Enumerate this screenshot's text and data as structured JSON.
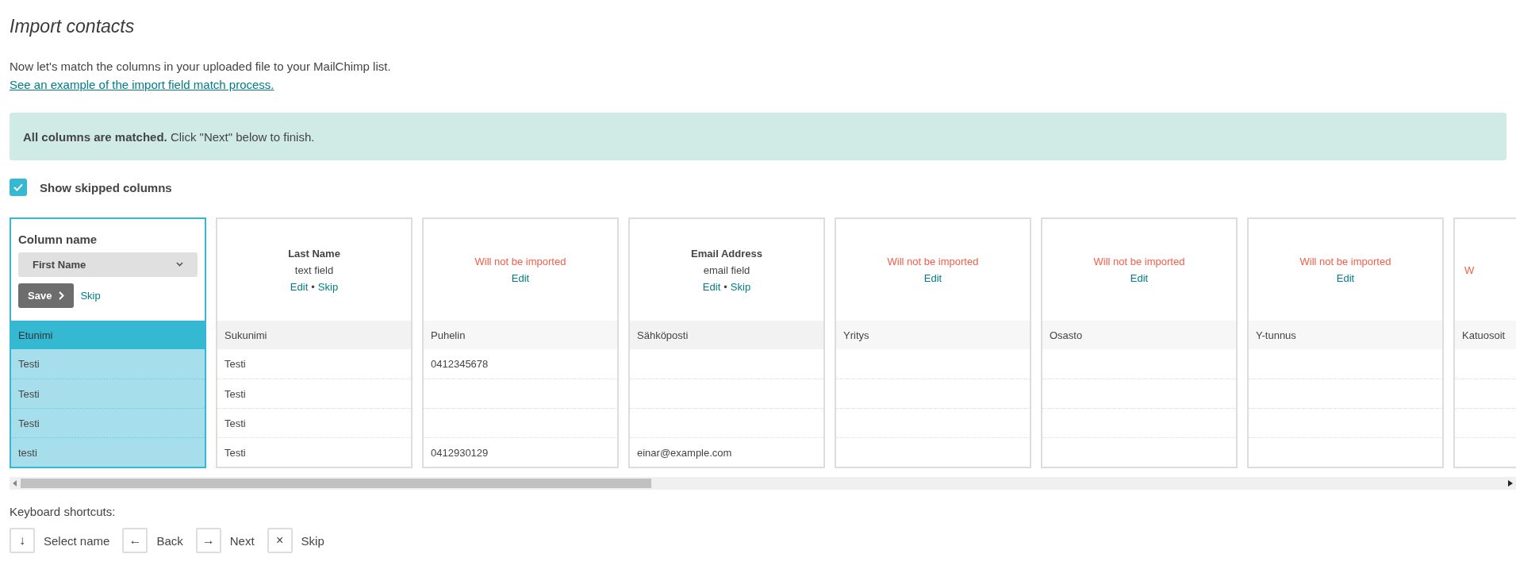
{
  "title": "Import contacts",
  "intro": "Now let's match the columns in your uploaded file to your MailChimp list.",
  "example_link": "See an example of the import field match process.",
  "notice": "**All columns are matched.** Click \"Next\" below to finish.",
  "show_skipped": {
    "label": "Show skipped columns",
    "checked": true
  },
  "columns": [
    {
      "kind": "editing",
      "selected": true,
      "label": "Column name",
      "select_value": "First Name",
      "save_button": "Save",
      "skip_link": "Skip",
      "header": "Etunimi",
      "cells": [
        {
          "text": "Testi"
        },
        {
          "text": "Testi"
        },
        {
          "text": "Testi"
        },
        {
          "text": "testi"
        }
      ]
    },
    {
      "kind": "matched",
      "selected": false,
      "field_name": "Last Name",
      "field_type": "text field",
      "actions": [
        "Edit",
        "Skip"
      ],
      "separator": "•",
      "header": "Sukunimi",
      "cells": [
        {
          "text": "Testi"
        },
        {
          "text": "Testi"
        },
        {
          "text": "Testi"
        },
        {
          "text": "Testi"
        }
      ]
    },
    {
      "kind": "skipped",
      "selected": false,
      "status": "Will not be imported",
      "actions": [
        "Edit"
      ],
      "header": "Puhelin",
      "cells": [
        {
          "text": "0412345678"
        },
        {},
        {},
        {
          "text": "0412930129"
        }
      ]
    },
    {
      "kind": "matched",
      "selected": false,
      "field_name": "Email Address",
      "field_type": "email field",
      "actions": [
        "Edit",
        "Skip"
      ],
      "separator": "•",
      "header": "Sähköposti",
      "cells": [
        {},
        {},
        {},
        {
          "text": "einar@example.com"
        }
      ]
    },
    {
      "kind": "skipped",
      "selected": false,
      "status": "Will not be imported",
      "actions": [
        "Edit"
      ],
      "header": "Yritys",
      "cells": [
        {},
        {},
        {},
        {}
      ]
    },
    {
      "kind": "skipped",
      "selected": false,
      "status": "Will not be imported",
      "actions": [
        "Edit"
      ],
      "header": "Osasto",
      "cells": [
        {},
        {},
        {},
        {}
      ]
    },
    {
      "kind": "skipped",
      "selected": false,
      "status": "Will not be imported",
      "actions": [
        "Edit"
      ],
      "header": "Y-tunnus",
      "cells": [
        {},
        {},
        {},
        {}
      ]
    },
    {
      "kind": "cut",
      "selected": false,
      "status": "W",
      "header": "Katuosoit",
      "cells": [
        {},
        {},
        {},
        {}
      ]
    }
  ],
  "shortcuts_label": "Keyboard shortcuts:",
  "shortcuts": [
    {
      "key": "↓",
      "label": "Select name"
    },
    {
      "key": "←",
      "label": "Back"
    },
    {
      "key": "→",
      "label": "Next"
    },
    {
      "key": "×",
      "label": "Skip"
    }
  ]
}
